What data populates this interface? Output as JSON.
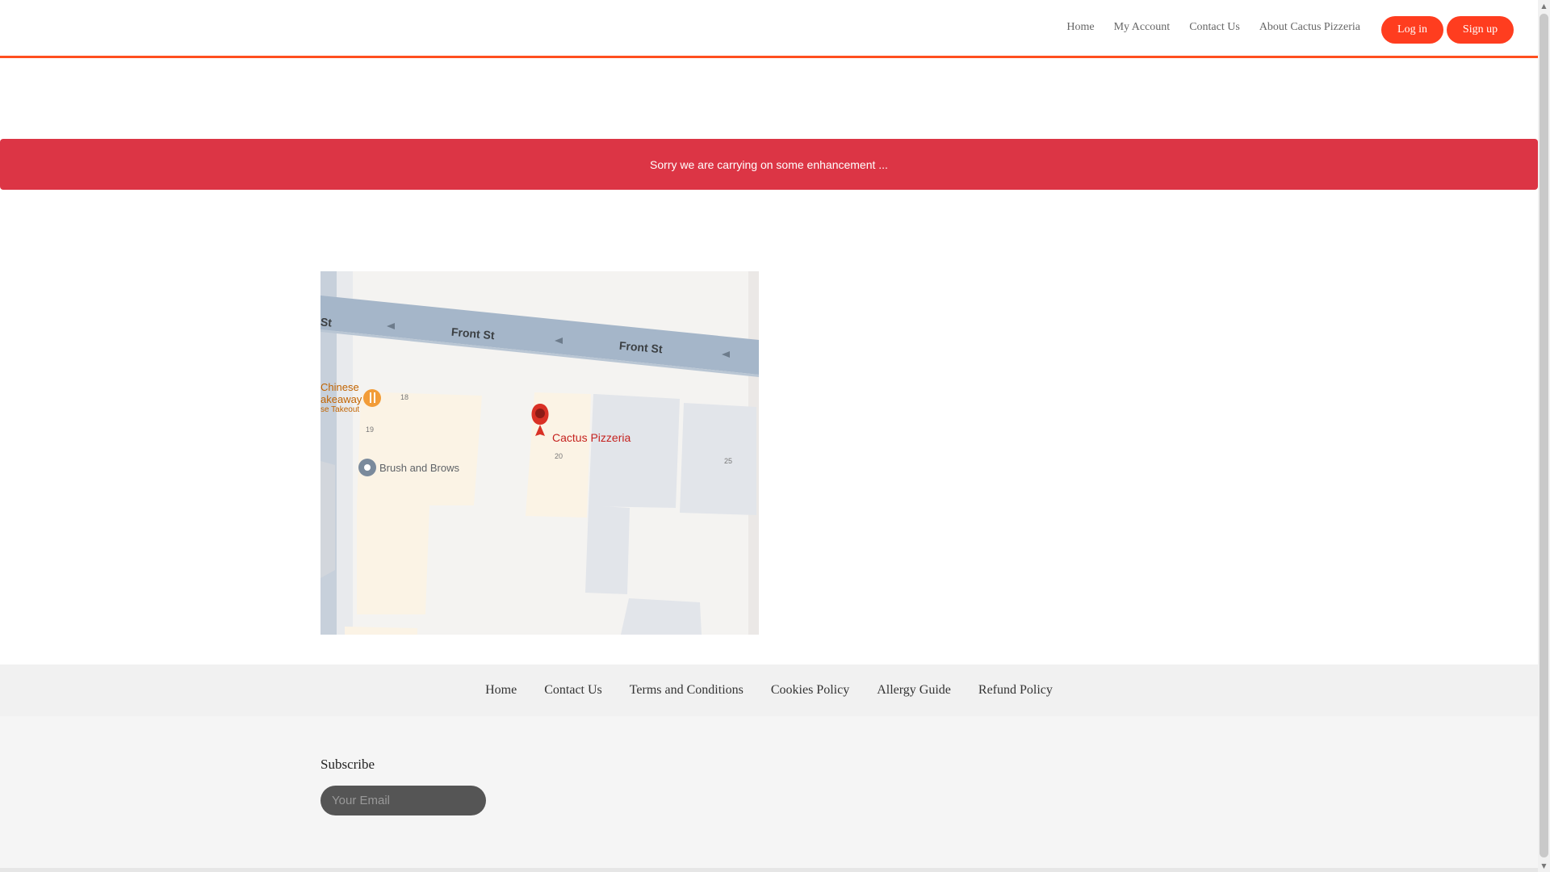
{
  "header": {
    "nav": [
      "Home",
      "My Account",
      "Contact Us",
      "About Cactus Pizzeria"
    ],
    "login_label": "Log in",
    "signup_label": "Sign up",
    "accent_color": "#ff3d1f"
  },
  "alert": {
    "message": "Sorry we are carrying on some enhancement ...",
    "color": "#dc3545"
  },
  "map": {
    "streets": [
      "Front St",
      "Front St",
      "St"
    ],
    "places": [
      {
        "name": "Cactus Pizzeria",
        "icon": "red-map-pin-icon"
      },
      {
        "name": "Brush and Brows",
        "icon": "grey-map-pin-icon"
      },
      {
        "name": "Chinese Takeaway",
        "icon": "restaurant-pin-icon",
        "visible_text": [
          "Chinese",
          "akeaway",
          "se Takeout"
        ]
      }
    ],
    "numbers": [
      "18",
      "19",
      "20",
      "25"
    ]
  },
  "footer": {
    "links": [
      "Home",
      "Contact Us",
      "Terms and Conditions",
      "Cookies Policy",
      "Allergy Guide",
      "Refund Policy"
    ]
  },
  "subscribe": {
    "title": "Subscribe",
    "email_placeholder": "Your Email",
    "email_value": ""
  }
}
